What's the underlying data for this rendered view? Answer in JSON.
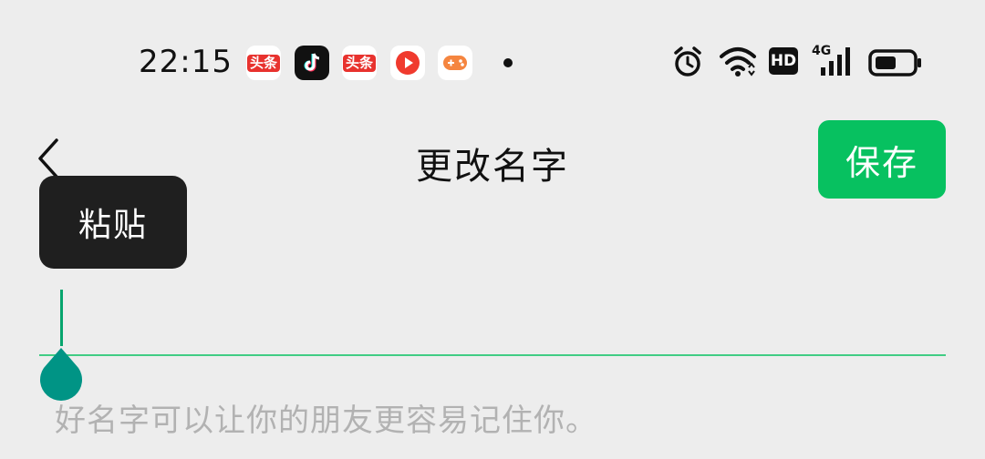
{
  "status_bar": {
    "time": "22:15",
    "apps": [
      {
        "name": "toutiao-app-icon",
        "label": "头条"
      },
      {
        "name": "douyin-app-icon",
        "label": ""
      },
      {
        "name": "toutiao-app-icon-2",
        "label": "头条"
      },
      {
        "name": "video-app-icon",
        "label": ""
      },
      {
        "name": "game-app-icon",
        "label": ""
      }
    ],
    "network": "4G",
    "hd": "HD"
  },
  "header": {
    "title": "更改名字",
    "save_label": "保存"
  },
  "popup": {
    "paste_label": "粘贴"
  },
  "input": {
    "value": "",
    "hint": "好名字可以让你的朋友更容易记住你。"
  },
  "colors": {
    "accent": "#07c160",
    "background": "#ededed",
    "popup": "#1f1f1f",
    "handle": "#009485"
  }
}
